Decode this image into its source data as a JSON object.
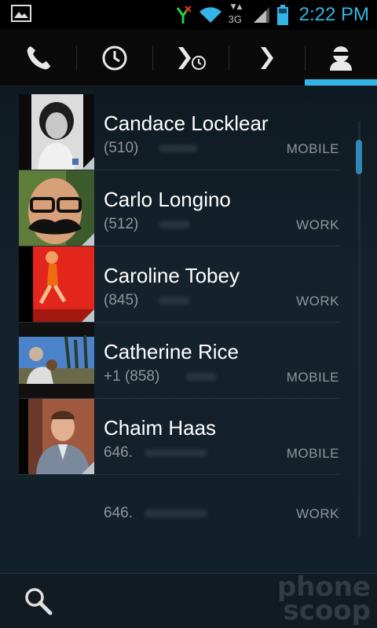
{
  "status_bar": {
    "time": "2:22 PM",
    "network_label": "3G",
    "accent": "#33b5e5"
  },
  "tabs": [
    {
      "name": "phone",
      "icon": "phone-icon",
      "selected": false
    },
    {
      "name": "recent",
      "icon": "clock-icon",
      "selected": false
    },
    {
      "name": "contact-groups",
      "icon": "chevron-clock-icon",
      "selected": false
    },
    {
      "name": "favorites",
      "icon": "chevron-icon",
      "selected": false
    },
    {
      "name": "contacts",
      "icon": "person-icon",
      "selected": true
    }
  ],
  "contacts": [
    {
      "name": "Candace Locklear",
      "phone": "(510)",
      "type": "MOBILE",
      "photo": "portrait-bw"
    },
    {
      "name": "Carlo Longino",
      "phone": "(512)",
      "type": "WORK",
      "photo": "man-glasses-mustache"
    },
    {
      "name": "Caroline Tobey",
      "phone": "(845)",
      "type": "WORK",
      "photo": "dancer-red"
    },
    {
      "name": "Catherine Rice",
      "phone": "+1 (858)",
      "type": "MOBILE",
      "photo": "outdoor-sky"
    },
    {
      "name": "Chaim Haas",
      "phone": "646.",
      "type": "MOBILE",
      "photo": "man-suit"
    }
  ],
  "partial_row": {
    "phone": "646.",
    "type": "WORK"
  },
  "bottom_bar": {
    "search_icon": "search-icon"
  },
  "watermark": {
    "line1": "phone",
    "line2": "scoop"
  }
}
